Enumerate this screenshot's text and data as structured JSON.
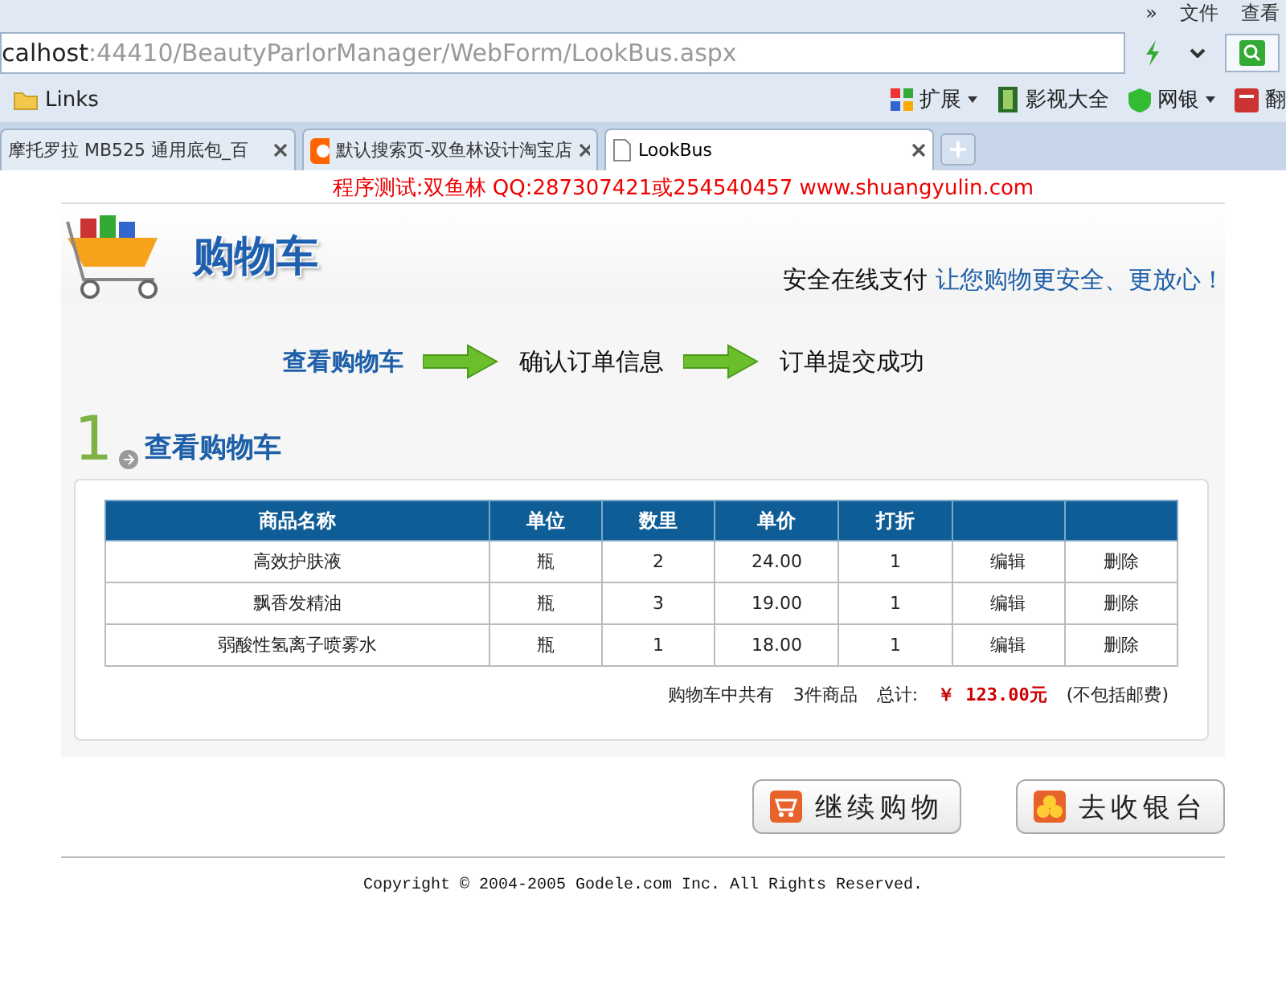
{
  "browser": {
    "menu": [
      "»",
      "文件",
      "查看"
    ],
    "address": {
      "host": "calhost",
      "path": ":44410/BeautyParlorManager/WebForm/LookBus.aspx"
    },
    "bookmarks": [
      {
        "label": "Links",
        "kind": "folder"
      }
    ],
    "toolbar_items": [
      {
        "label": "扩展",
        "kind": "apps",
        "dropdown": true
      },
      {
        "label": "影视大全",
        "kind": "film",
        "dropdown": false
      },
      {
        "label": "网银",
        "kind": "shield",
        "dropdown": true
      },
      {
        "label": "翻",
        "kind": "translate",
        "dropdown": false
      }
    ],
    "tabs": [
      {
        "title": "摩托罗拉 MB525 通用底包_百",
        "selected": false,
        "kind": "blank"
      },
      {
        "title": "默认搜索页-双鱼林设计淘宝店",
        "selected": false,
        "kind": "taobao"
      },
      {
        "title": "LookBus",
        "selected": true,
        "kind": "page"
      }
    ]
  },
  "page": {
    "notice": "程序测试:双鱼林 QQ:287307421或254540457 www.shuangyulin.com",
    "logo_title": "购物车",
    "slogan": {
      "lead": "安全在线支付",
      "tail": "让您购物更安全、更放心！"
    },
    "steps": [
      {
        "label": "查看购物车",
        "selected": true
      },
      {
        "label": "确认订单信息",
        "selected": false
      },
      {
        "label": "订单提交成功",
        "selected": false
      }
    ],
    "section": {
      "number": "1",
      "title": "查看购物车"
    },
    "table": {
      "columns": [
        "商品名称",
        "单位",
        "数里",
        "单价",
        "打折",
        "",
        ""
      ],
      "rows": [
        {
          "name": "高效护肤液",
          "unit": "瓶",
          "qty": "2",
          "price": "24.00",
          "discount": "1",
          "edit": "编辑",
          "delete": "删除"
        },
        {
          "name": "飘香发精油",
          "unit": "瓶",
          "qty": "3",
          "price": "19.00",
          "discount": "1",
          "edit": "编辑",
          "delete": "删除"
        },
        {
          "name": "弱酸性氢离子喷雾水",
          "unit": "瓶",
          "qty": "1",
          "price": "18.00",
          "discount": "1",
          "edit": "编辑",
          "delete": "删除"
        }
      ]
    },
    "summary": {
      "count_label": "购物车中共有",
      "count": "3件商品",
      "total_label": "总计:",
      "total": "￥ 123.00元",
      "note": "(不包括邮费)"
    },
    "buttons": [
      {
        "label": "继续购物",
        "kind": "cart"
      },
      {
        "label": "去收银台",
        "kind": "coins"
      }
    ],
    "copyright": "Copyright © 2004-2005 Godele.com Inc. All Rights Reserved."
  }
}
